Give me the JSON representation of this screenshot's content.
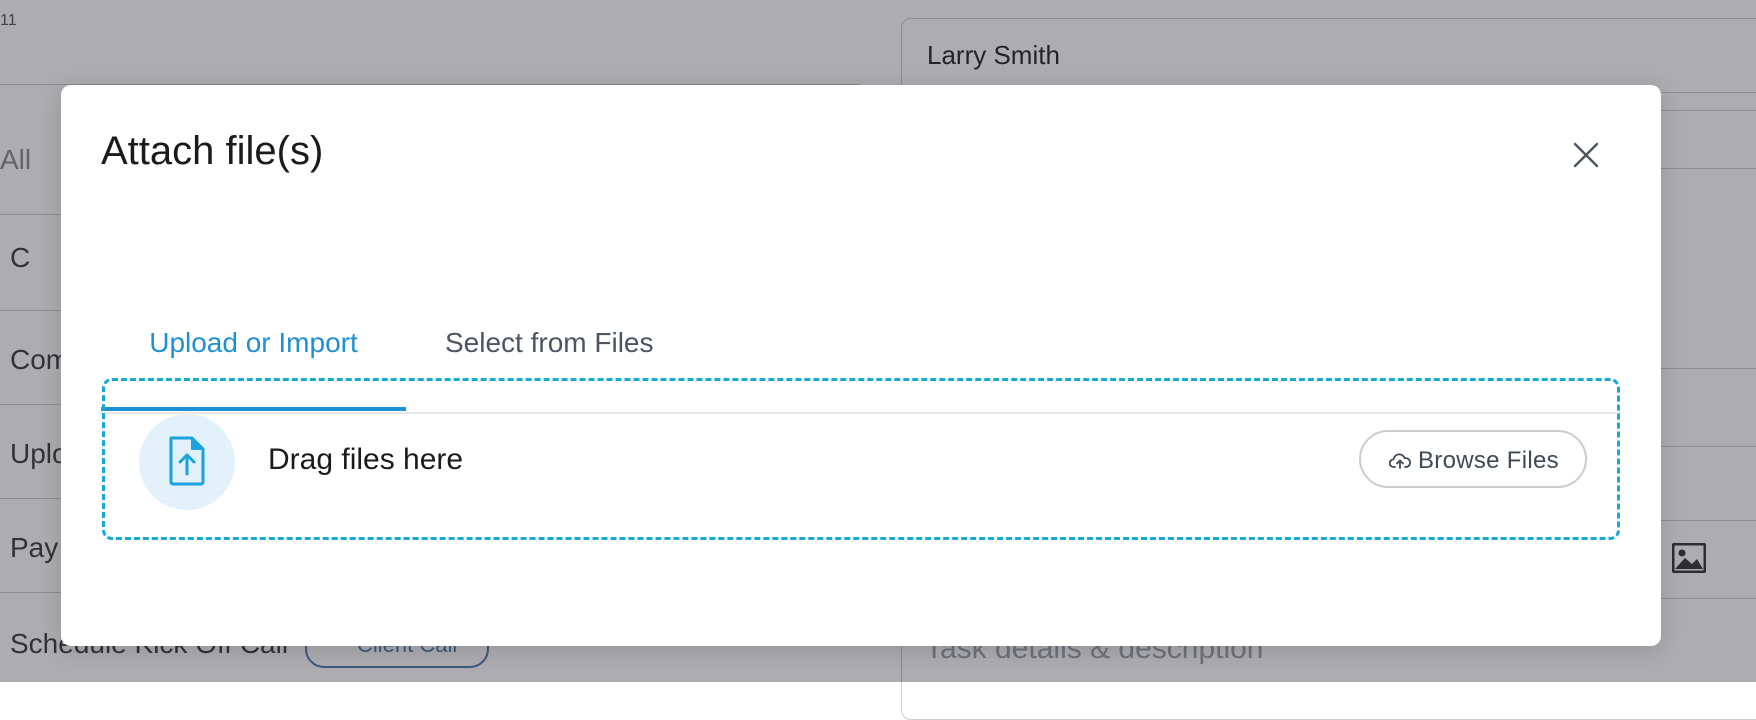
{
  "background": {
    "top_left_fragment": "11",
    "filter_fragment": "All",
    "status_fragment": "C",
    "rows": [
      "Com",
      "Uplo",
      "Pay",
      "Schedule Kick Off Call"
    ],
    "client_chip": "Client Call",
    "contact_name": "Larry Smith",
    "description_placeholder": "Task details & description"
  },
  "modal": {
    "title": "Attach file(s)",
    "tabs": [
      {
        "label": "Upload or Import",
        "active": true
      },
      {
        "label": "Select from Files",
        "active": false
      }
    ],
    "dropzone": {
      "text": "Drag files here",
      "browse_label": "Browse Files"
    }
  },
  "colors": {
    "accent": "#1f8fd6",
    "dropzone_border": "#17a8d8",
    "overlay": "rgba(40,40,50,0.38)"
  },
  "icons": [
    "close-icon",
    "file-upload-icon",
    "cloud-upload-icon",
    "image-icon"
  ]
}
